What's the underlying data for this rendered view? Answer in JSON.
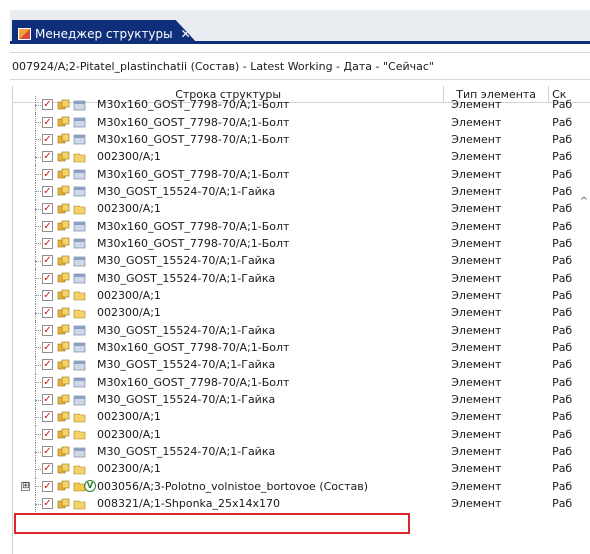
{
  "tab": {
    "title": "Менеджер структуры",
    "close": "✕"
  },
  "path": "007924/A;2-Pitatel_plastinchatii (Состав) - Latest Working - Дата - \"Сейчас\"",
  "columns": [
    "Строка структуры",
    "Тип элемента",
    "Ск"
  ],
  "rows": [
    {
      "label": "M30x160_GOST_7798-70/A;1-Болт",
      "type": "Элемент",
      "status": "Раб",
      "icon": "part"
    },
    {
      "label": "M30x160_GOST_7798-70/A;1-Болт",
      "type": "Элемент",
      "status": "Раб",
      "icon": "part"
    },
    {
      "label": "M30x160_GOST_7798-70/A;1-Болт",
      "type": "Элемент",
      "status": "Раб",
      "icon": "part"
    },
    {
      "label": "002300/A;1",
      "type": "Элемент",
      "status": "Раб",
      "icon": "item"
    },
    {
      "label": "M30x160_GOST_7798-70/A;1-Болт",
      "type": "Элемент",
      "status": "Раб",
      "icon": "part"
    },
    {
      "label": "M30_GOST_15524-70/A;1-Гайка",
      "type": "Элемент",
      "status": "Раб",
      "icon": "part"
    },
    {
      "label": "002300/A;1",
      "type": "Элемент",
      "status": "Раб",
      "icon": "item"
    },
    {
      "label": "M30x160_GOST_7798-70/A;1-Болт",
      "type": "Элемент",
      "status": "Раб",
      "icon": "part"
    },
    {
      "label": "M30x160_GOST_7798-70/A;1-Болт",
      "type": "Элемент",
      "status": "Раб",
      "icon": "part"
    },
    {
      "label": "M30_GOST_15524-70/A;1-Гайка",
      "type": "Элемент",
      "status": "Раб",
      "icon": "part"
    },
    {
      "label": "M30_GOST_15524-70/A;1-Гайка",
      "type": "Элемент",
      "status": "Раб",
      "icon": "part"
    },
    {
      "label": "002300/A;1",
      "type": "Элемент",
      "status": "Раб",
      "icon": "item"
    },
    {
      "label": "002300/A;1",
      "type": "Элемент",
      "status": "Раб",
      "icon": "item"
    },
    {
      "label": "M30_GOST_15524-70/A;1-Гайка",
      "type": "Элемент",
      "status": "Раб",
      "icon": "part"
    },
    {
      "label": "M30x160_GOST_7798-70/A;1-Болт",
      "type": "Элемент",
      "status": "Раб",
      "icon": "part"
    },
    {
      "label": "M30_GOST_15524-70/A;1-Гайка",
      "type": "Элемент",
      "status": "Раб",
      "icon": "part"
    },
    {
      "label": "M30x160_GOST_7798-70/A;1-Болт",
      "type": "Элемент",
      "status": "Раб",
      "icon": "part"
    },
    {
      "label": "M30_GOST_15524-70/A;1-Гайка",
      "type": "Элемент",
      "status": "Раб",
      "icon": "part"
    },
    {
      "label": "002300/A;1",
      "type": "Элемент",
      "status": "Раб",
      "icon": "item"
    },
    {
      "label": "002300/A;1",
      "type": "Элемент",
      "status": "Раб",
      "icon": "item"
    },
    {
      "label": "M30_GOST_15524-70/A;1-Гайка",
      "type": "Элемент",
      "status": "Раб",
      "icon": "part"
    },
    {
      "label": "002300/A;1",
      "type": "Элемент",
      "status": "Раб",
      "icon": "item"
    },
    {
      "label": "003056/A;3-Polotno_volnistoe_bortovoe (Состав)",
      "type": "Элемент",
      "status": "Раб",
      "icon": "assembly",
      "expander": "⊞",
      "badge": "V"
    },
    {
      "label": "008321/A;1-Shponka_25x14x170",
      "type": "Элемент",
      "status": "Раб",
      "icon": "item"
    }
  ],
  "icons": {
    "check": "✓",
    "scroll_up": "^"
  },
  "colors": {
    "accent": "#0f2f7a",
    "highlight": "#d8262b",
    "check": "#d01818"
  }
}
